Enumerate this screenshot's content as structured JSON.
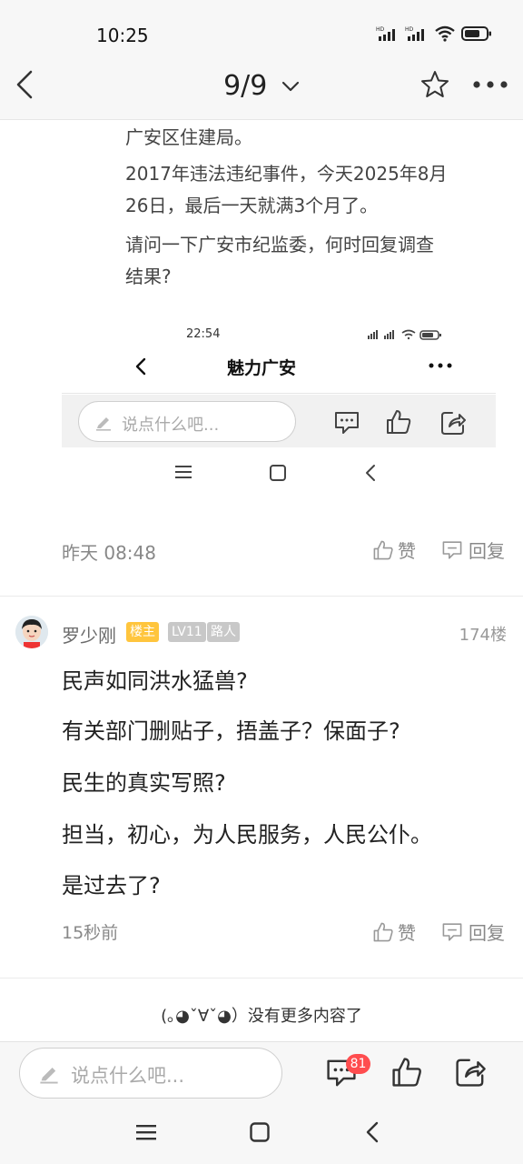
{
  "status_bar": {
    "time": "10:25",
    "icons": [
      "hd-signal-icon",
      "hd-signal-icon",
      "wifi-icon",
      "battery-icon"
    ]
  },
  "header": {
    "page_indicator": "9/9",
    "icons": [
      "back-icon",
      "chevron-down-icon",
      "star-icon",
      "more-icon"
    ]
  },
  "post": {
    "paragraphs": [
      "广安区住建局。",
      "2017年违法违纪事件，今天2025年8月",
      "26日，最后一天就满3个月了。",
      "请问一下广安市纪监委，何时回复调查",
      "结果?"
    ],
    "screenshot": {
      "time": "22:54",
      "title": "魅力广安",
      "input_placeholder": "说点什么吧..."
    },
    "time": "昨天 08:48",
    "like_label": "赞",
    "reply_label": "回复"
  },
  "comment": {
    "username": "罗少刚",
    "badges": [
      "楼主",
      "LV11",
      "路人"
    ],
    "floor": "174楼",
    "lines": [
      "民声如同洪水猛兽?",
      "有关部门删贴子，捂盖子？保面子?",
      "民生的真实写照?",
      "担当，初心，为人民服务，人民公仆。",
      "是过去了?"
    ],
    "time": "15秒前",
    "like_label": "赞",
    "reply_label": "回复"
  },
  "footer": {
    "no_more": "(｡◕ˇ∀ˇ◕）没有更多内容了"
  },
  "bottom_bar": {
    "input_placeholder": "说点什么吧...",
    "comment_count": "81"
  },
  "colors": {
    "badge_owner_bg": "#ffc53d",
    "badge_level_bg": "#c8c8c8",
    "badge_role_bg": "#c8c8c8",
    "count_badge_bg": "#ff4d4f"
  }
}
